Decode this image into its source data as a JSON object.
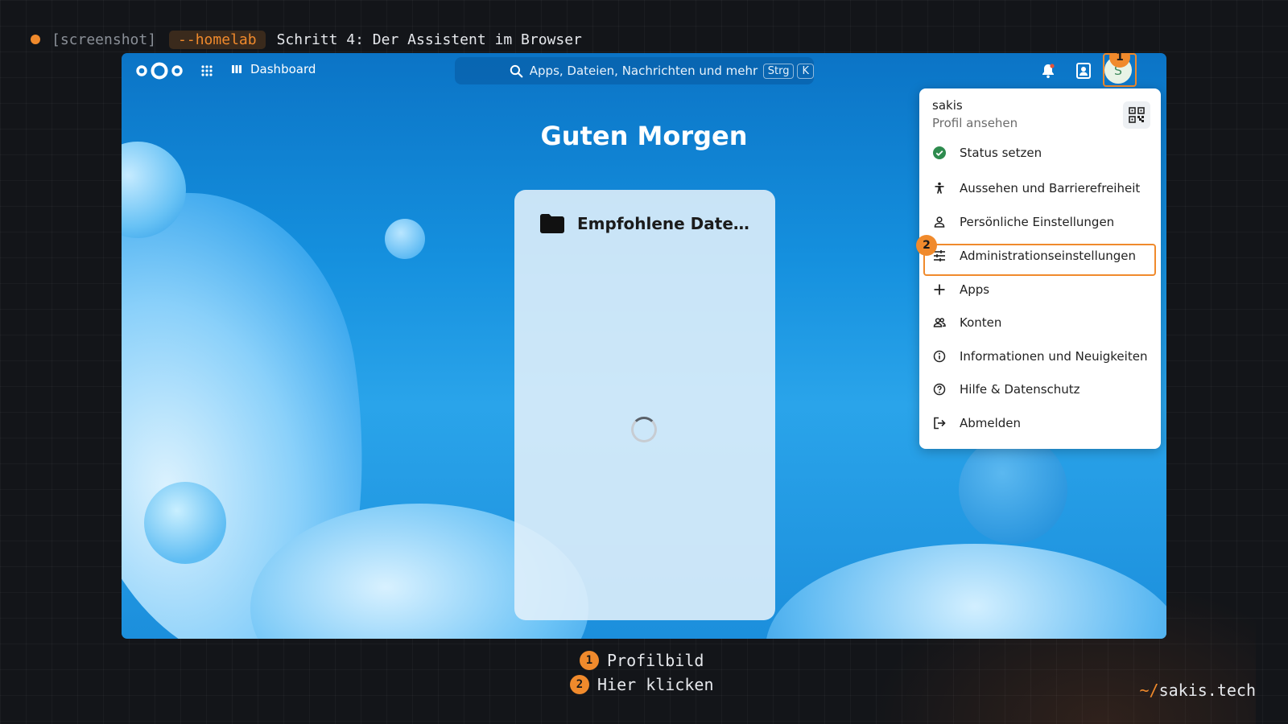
{
  "header": {
    "tag": "[screenshot]",
    "chip": "--homelab",
    "step_title": "Schritt 4: Der Assistent im Browser"
  },
  "nav": {
    "dashboard_label": "Dashboard",
    "search_placeholder": "Apps, Dateien, Nachrichten und mehr",
    "shortcut_key1": "Strg",
    "shortcut_key2": "K",
    "avatar_initial": "S"
  },
  "main": {
    "greeting": "Guten Morgen",
    "card_title": "Empfohlene Date…"
  },
  "menu": {
    "username": "sakis",
    "profile_link": "Profil ansehen",
    "items": [
      {
        "label": "Status setzen",
        "icon": "status-check-icon"
      },
      {
        "label": "Aussehen und Barrierefreiheit",
        "icon": "accessibility-icon"
      },
      {
        "label": "Persönliche Einstellungen",
        "icon": "person-icon"
      },
      {
        "label": "Administrationseinstellungen",
        "icon": "sliders-icon"
      },
      {
        "label": "Apps",
        "icon": "plus-icon"
      },
      {
        "label": "Konten",
        "icon": "accounts-icon"
      },
      {
        "label": "Informationen und Neuigkeiten",
        "icon": "info-icon"
      },
      {
        "label": "Hilfe & Datenschutz",
        "icon": "help-icon"
      },
      {
        "label": "Abmelden",
        "icon": "logout-icon"
      }
    ]
  },
  "annotations": {
    "badge1": "1",
    "badge2": "2",
    "legend": [
      {
        "num": "1",
        "text": "Profilbild"
      },
      {
        "num": "2",
        "text": "Hier klicken"
      }
    ]
  },
  "footer": {
    "prefix": "~/",
    "site": "sakis.tech"
  },
  "colors": {
    "accent": "#f08a2c",
    "background": "#131519",
    "status_green": "#2e8b4e"
  }
}
